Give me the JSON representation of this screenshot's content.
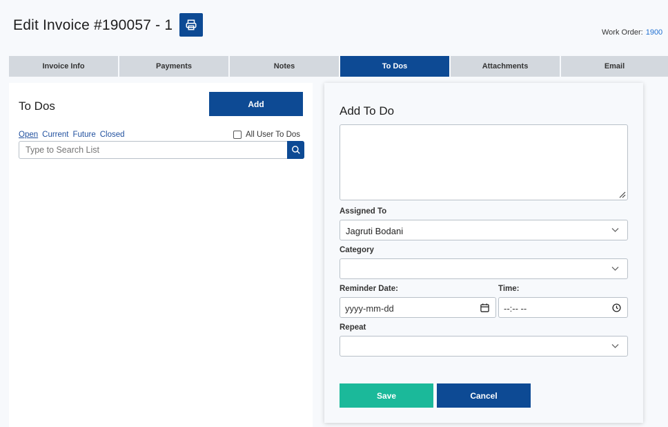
{
  "header": {
    "title": "Edit Invoice #190057 - 1",
    "print_icon": "printer-icon",
    "work_order_label": "Work Order:",
    "work_order_value": "1900"
  },
  "tabs": [
    {
      "label": "Invoice Info",
      "active": false
    },
    {
      "label": "Payments",
      "active": false
    },
    {
      "label": "Notes",
      "active": false
    },
    {
      "label": "To Dos",
      "active": true
    },
    {
      "label": "Attachments",
      "active": false
    },
    {
      "label": "Email",
      "active": false
    }
  ],
  "todos": {
    "title": "To Dos",
    "add_label": "Add",
    "filters": [
      "Open",
      "Current",
      "Future",
      "Closed"
    ],
    "active_filter": "Open",
    "all_user_label": "All User To Dos",
    "all_user_checked": false,
    "search_placeholder": "Type to Search List",
    "search_icon": "search-icon"
  },
  "form": {
    "title": "Add To Do",
    "description_value": "",
    "assigned_to_label": "Assigned To",
    "assigned_to_value": "Jagruti Bodani",
    "category_label": "Category",
    "category_value": "",
    "reminder_date_label": "Reminder Date:",
    "reminder_date_placeholder": "yyyy-mm-dd",
    "time_label": "Time:",
    "time_placeholder": "--:-- --",
    "repeat_label": "Repeat",
    "repeat_value": "",
    "save_label": "Save",
    "cancel_label": "Cancel"
  },
  "colors": {
    "primary": "#0d4a94",
    "save": "#1bb99a",
    "tab_inactive": "#d3d8de",
    "link": "#1f4f9e"
  }
}
